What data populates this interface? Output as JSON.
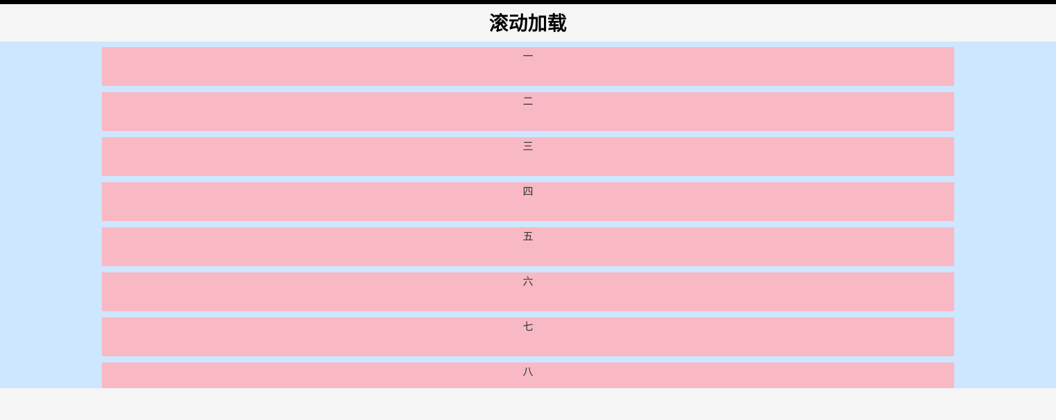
{
  "header": {
    "title": "滚动加载"
  },
  "list": {
    "items": [
      {
        "label": "一"
      },
      {
        "label": "二"
      },
      {
        "label": "三"
      },
      {
        "label": "四"
      },
      {
        "label": "五"
      },
      {
        "label": "六"
      },
      {
        "label": "七"
      },
      {
        "label": "八"
      }
    ]
  }
}
